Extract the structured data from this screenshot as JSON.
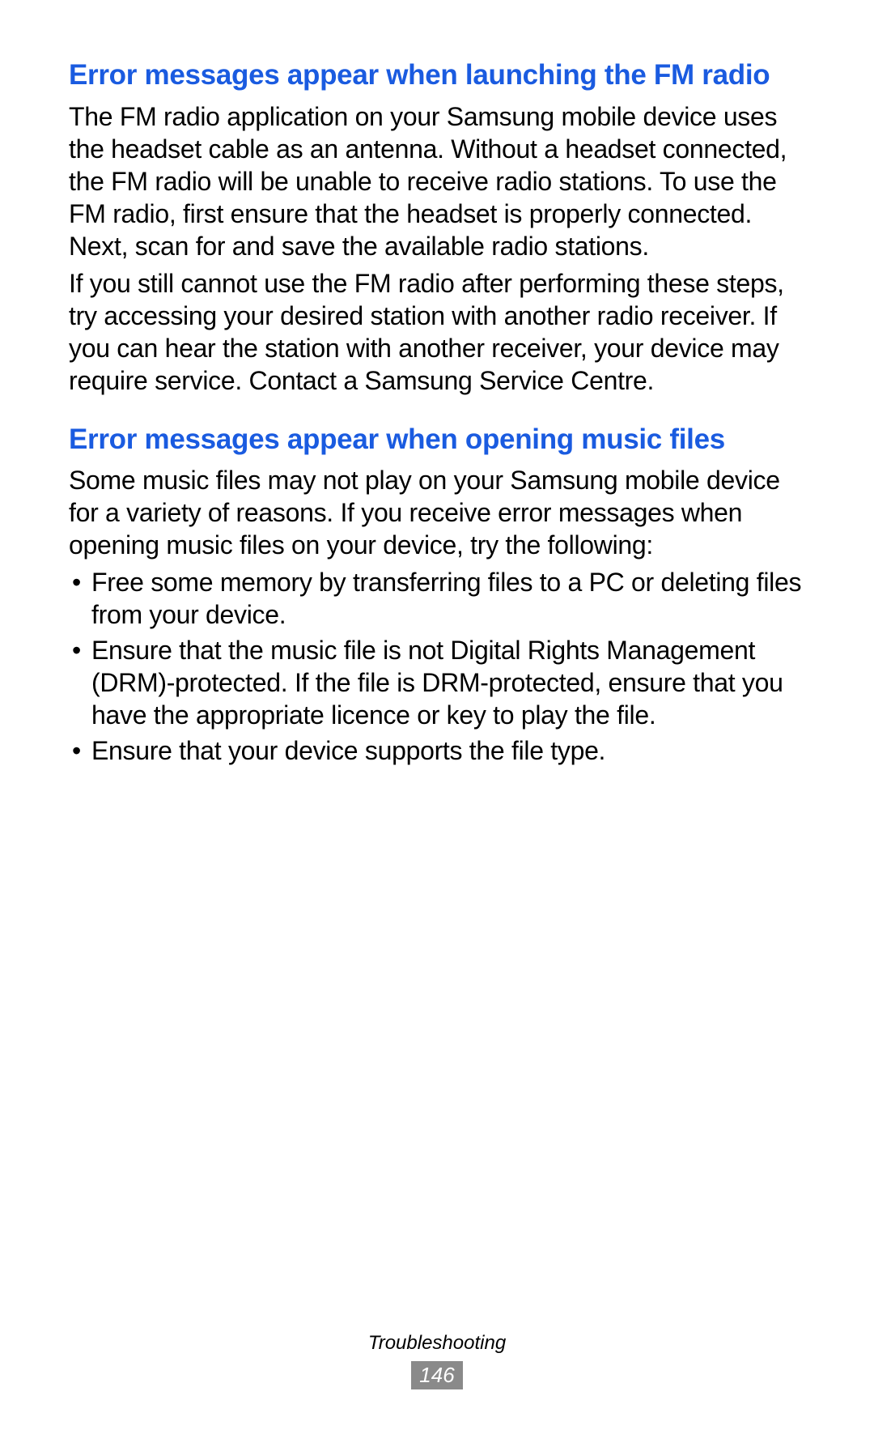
{
  "sections": [
    {
      "heading": "Error messages appear when launching the FM radio",
      "paragraphs": [
        "The FM radio application on your Samsung mobile device uses the headset cable as an antenna. Without a headset connected, the FM radio will be unable to receive radio stations. To use the FM radio, first ensure that the headset is properly connected. Next, scan for and save the available radio stations.",
        "If you still cannot use the FM radio after performing these steps, try accessing your desired station with another radio receiver. If you can hear the station with another receiver, your device may require service. Contact a Samsung Service Centre."
      ],
      "bullets": []
    },
    {
      "heading": "Error messages appear when opening music files",
      "paragraphs": [
        "Some music files may not play on your Samsung mobile device for a variety of reasons. If you receive error messages when opening music files on your device, try the following:"
      ],
      "bullets": [
        "Free some memory by transferring files to a PC or deleting files from your device.",
        "Ensure that the music file is not Digital Rights Management (DRM)-protected. If the file is DRM-protected, ensure that you have the appropriate licence or key to play the file.",
        "Ensure that your device supports the file type."
      ]
    }
  ],
  "footer": {
    "label": "Troubleshooting",
    "page": "146"
  }
}
